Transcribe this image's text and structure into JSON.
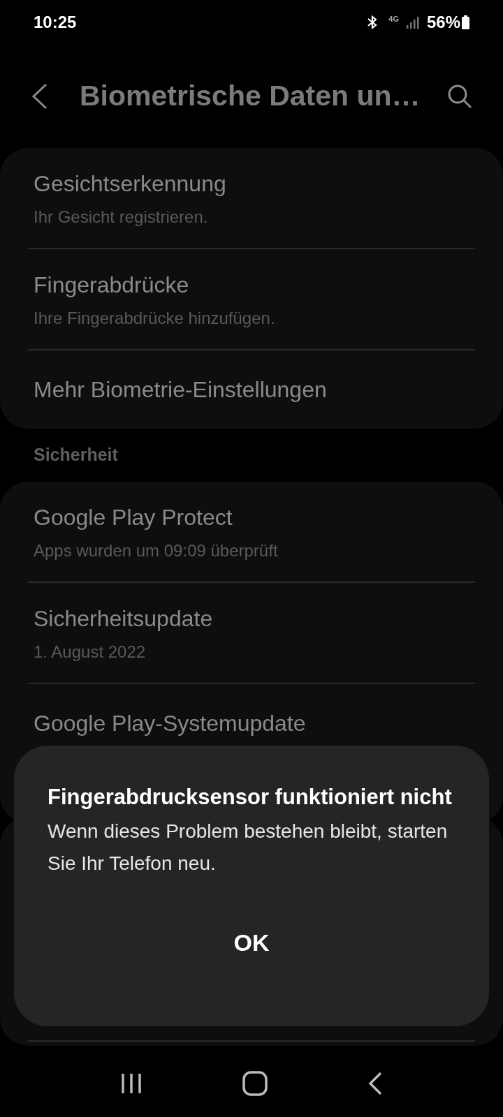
{
  "status_bar": {
    "time": "10:25",
    "network": "4G",
    "battery": "56%"
  },
  "header": {
    "title": "Biometrische Daten un…"
  },
  "groups": [
    {
      "items": [
        {
          "title": "Gesichtserkennung",
          "subtitle": "Ihr Gesicht registrieren."
        },
        {
          "title": "Fingerabdrücke",
          "subtitle": "Ihre Fingerabdrücke hinzufügen."
        },
        {
          "title": "Mehr Biometrie-Einstellungen"
        }
      ]
    },
    {
      "heading": "Sicherheit",
      "items": [
        {
          "title": "Google Play Protect",
          "subtitle": "Apps wurden um 09:09 überprüft"
        },
        {
          "title": "Sicherheitsupdate",
          "subtitle": "1. August 2022"
        },
        {
          "title": "Google Play-Systemupdate"
        }
      ]
    }
  ],
  "dialog": {
    "title": "Fingerabdrucksensor funktioniert nicht",
    "message": "Wenn dieses Problem bestehen bleibt, starten Sie Ihr Telefon neu.",
    "buttons": [
      "OK"
    ]
  }
}
